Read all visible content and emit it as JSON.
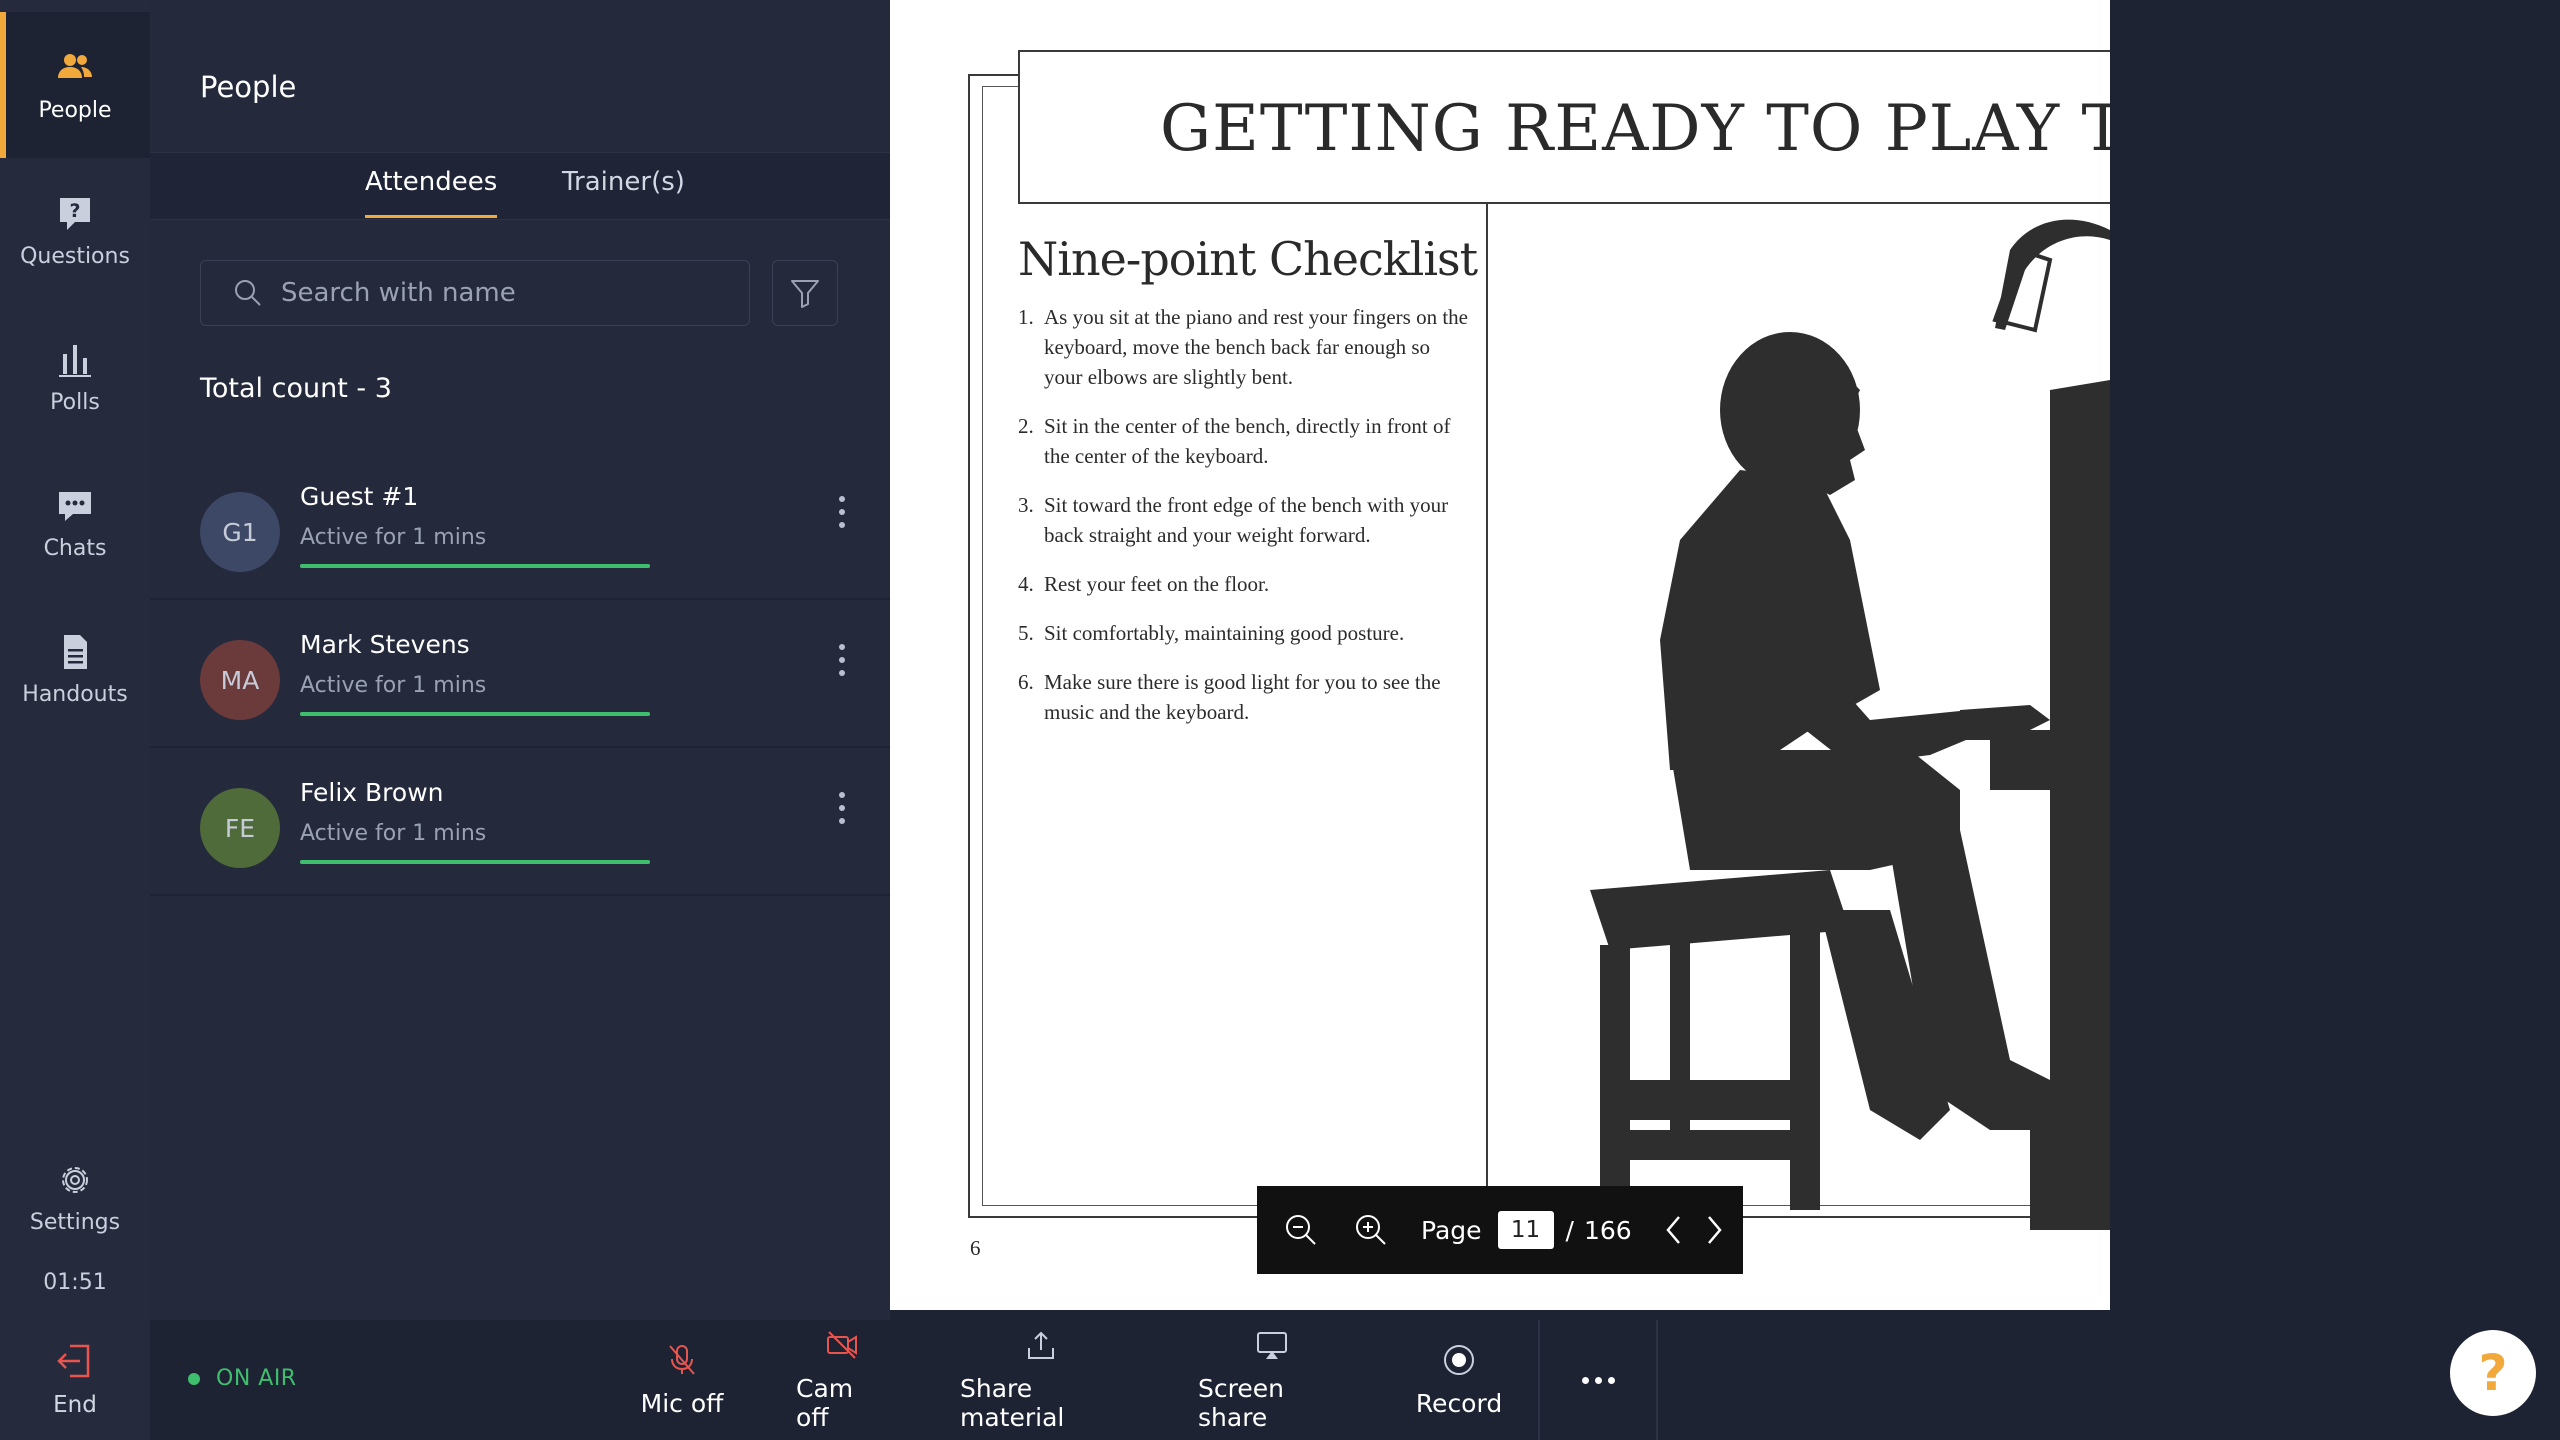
{
  "rail": {
    "items": [
      {
        "label": "People",
        "icon": "people-icon",
        "active": true
      },
      {
        "label": "Questions",
        "icon": "question-icon"
      },
      {
        "label": "Polls",
        "icon": "bar-chart-icon"
      },
      {
        "label": "Chats",
        "icon": "chat-icon"
      },
      {
        "label": "Handouts",
        "icon": "document-icon"
      }
    ],
    "settings_label": "Settings",
    "timer": "01:51"
  },
  "panel": {
    "title": "People",
    "tabs": [
      {
        "label": "Attendees",
        "active": true
      },
      {
        "label": "Trainer(s)"
      }
    ],
    "search_placeholder": "Search with name",
    "total_count": "Total count - 3",
    "attendees": [
      {
        "initials": "G1",
        "name": "Guest #1",
        "status": "Active for 1 mins",
        "avatar_color": "#3d4766",
        "activity": 1.0
      },
      {
        "initials": "MA",
        "name": "Mark Stevens",
        "status": "Active for 1 mins",
        "avatar_color": "#6b3a3a",
        "activity": 1.0
      },
      {
        "initials": "FE",
        "name": "Felix Brown",
        "status": "Active for 1 mins",
        "avatar_color": "#4f6b3a",
        "activity": 1.0
      }
    ]
  },
  "document": {
    "title": "GETTING READY TO PLAY THE",
    "subtitle": "Nine-point Checklist",
    "items": [
      {
        "num": "1.",
        "text": "As you sit at the piano and rest your fingers on the keyboard, move the bench back far enough so your elbows are slightly bent."
      },
      {
        "num": "2.",
        "text": "Sit in the center of the bench, directly in front of the center of the keyboard."
      },
      {
        "num": "3.",
        "text": "Sit toward the front edge of the bench with your back straight and your weight forward."
      },
      {
        "num": "4.",
        "text": "Rest your feet on the floor."
      },
      {
        "num": "5.",
        "text": "Sit comfortably, maintaining good posture."
      },
      {
        "num": "6.",
        "text": "Make sure there is good light for you to see the music and the keyboard."
      }
    ],
    "page_number": "6"
  },
  "page_control": {
    "label": "Page",
    "current": "11",
    "separator": "/",
    "total": "166"
  },
  "bottombar": {
    "end_label": "End",
    "onair_label": "ON AIR",
    "buttons": [
      {
        "label": "Mic off",
        "icon": "mic-off-icon"
      },
      {
        "label": "Cam off",
        "icon": "cam-off-icon"
      },
      {
        "label": "Share material",
        "icon": "share-icon"
      },
      {
        "label": "Screen share",
        "icon": "screen-share-icon"
      },
      {
        "label": "Record",
        "icon": "record-icon"
      }
    ]
  },
  "colors": {
    "accent": "#f2a93b",
    "live": "#3fbf6e",
    "danger": "#e8544e"
  },
  "help_label": "?"
}
